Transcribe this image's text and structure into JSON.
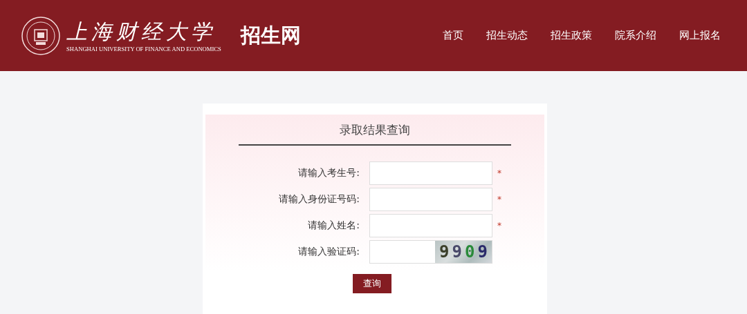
{
  "header": {
    "logo_name": "上海财经大学",
    "logo_subtitle": "SHANGHAI UNIVERSITY OF FINANCE AND ECONOMICS",
    "site_title": "招生网",
    "nav": [
      {
        "label": "首页"
      },
      {
        "label": "招生动态"
      },
      {
        "label": "招生政策"
      },
      {
        "label": "院系介绍"
      },
      {
        "label": "网上报名"
      }
    ]
  },
  "form": {
    "title": "录取结果查询",
    "fields": [
      {
        "label": "请输入考生号:",
        "required": true
      },
      {
        "label": "请输入身份证号码:",
        "required": true
      },
      {
        "label": "请输入姓名:",
        "required": true
      },
      {
        "label": "请输入验证码:",
        "required": false,
        "captcha": "9909"
      }
    ],
    "required_mark": "*",
    "submit": "查询"
  }
}
